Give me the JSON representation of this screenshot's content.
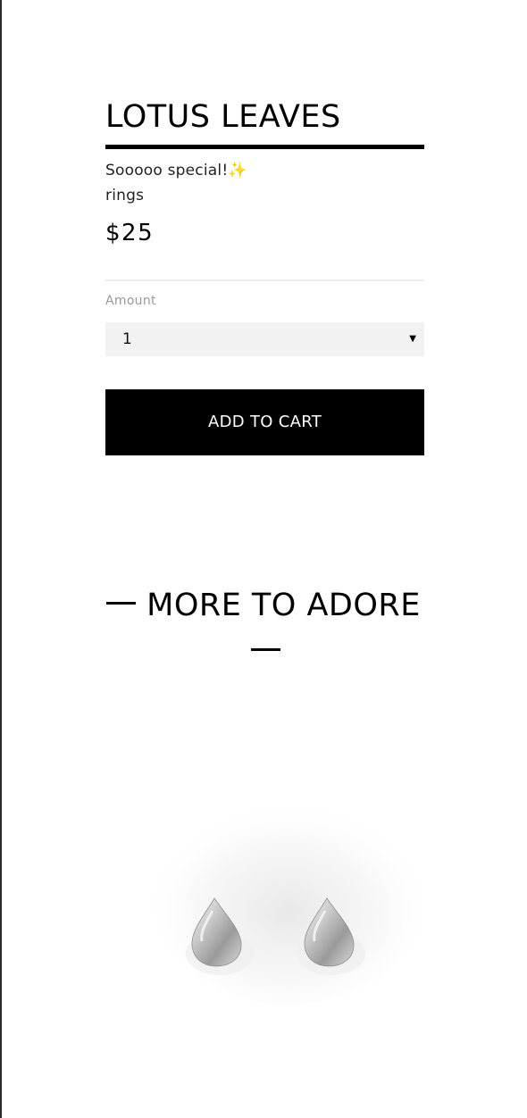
{
  "product": {
    "title": "LOTUS LEAVES",
    "description": "Sooooo special!✨",
    "category": "rings",
    "price": "$25"
  },
  "amount": {
    "label": "Amount",
    "selected": "1"
  },
  "actions": {
    "add_to_cart_label": "ADD TO CART"
  },
  "related": {
    "heading": "MORE TO ADORE",
    "item_image_icon": "earrings-image"
  },
  "colors": {
    "accent": "#000000",
    "select_bg": "#f2f2f2",
    "muted_text": "#9a9a9a"
  }
}
